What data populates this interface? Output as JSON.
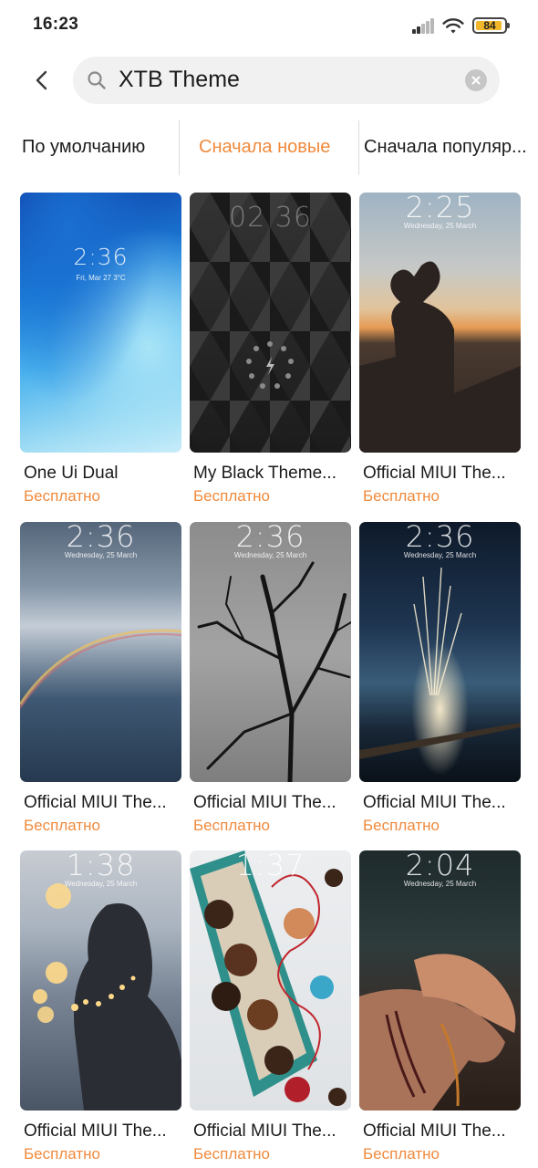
{
  "status_bar": {
    "time": "16:23",
    "battery_level": "84",
    "icons": [
      "signal-icon",
      "wifi-icon",
      "battery-icon"
    ]
  },
  "header": {
    "back_icon": "chevron-left-icon",
    "search_icon": "search-icon",
    "search_query": "XTB Theme",
    "clear_icon": "clear-icon"
  },
  "sort_tabs": [
    {
      "label": "По умолчанию",
      "active": false
    },
    {
      "label": "Сначала новые",
      "active": true
    },
    {
      "label": "Сначала популяр...",
      "active": false
    }
  ],
  "themes": [
    {
      "title": "One Ui Dual",
      "price": "Бесплатно",
      "clock": "2:36",
      "date": "Fri, Mar 27  3°C"
    },
    {
      "title": "My Black Theme...",
      "price": "Бесплатно",
      "clock": "02 36",
      "date": ""
    },
    {
      "title": "Official MIUI The...",
      "price": "Бесплатно",
      "clock": "2:25",
      "date": "Wednesday, 25 March"
    },
    {
      "title": "Official MIUI The...",
      "price": "Бесплатно",
      "clock": "2:36",
      "date": "Wednesday, 25 March"
    },
    {
      "title": "Official MIUI The...",
      "price": "Бесплатно",
      "clock": "2:36",
      "date": "Wednesday, 25 March"
    },
    {
      "title": "Official MIUI The...",
      "price": "Бесплатно",
      "clock": "2:36",
      "date": "Wednesday, 25 March"
    },
    {
      "title": "Official MIUI The...",
      "price": "Бесплатно",
      "clock": "1:38",
      "date": "Wednesday, 25 March"
    },
    {
      "title": "Official MIUI The...",
      "price": "Бесплатно",
      "clock": "1:37",
      "date": ""
    },
    {
      "title": "Official MIUI The...",
      "price": "Бесплатно",
      "clock": "2:04",
      "date": "Wednesday, 25 March"
    }
  ],
  "colors": {
    "accent": "#f08a3c",
    "search_bg": "#f1f1f1",
    "battery_fill": "#f0b72a"
  }
}
